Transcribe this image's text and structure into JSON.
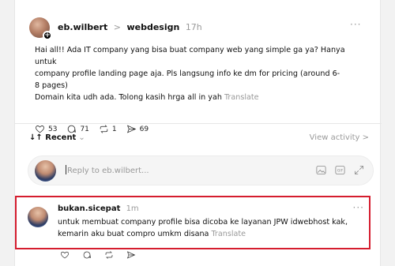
{
  "post": {
    "username": "eb.wilbert",
    "separator": ">",
    "topic": "webdesign",
    "time": "17h",
    "more": "···",
    "body_lines": [
      "Hai all!! Ada IT company yang bisa buat company web yang simple ga ya? Hanya untuk",
      "company profile landing page aja. Pls langsung info ke dm for pricing (around 6-",
      "8 pages)",
      "Domain kita udh ada. Tolong kasih hrga all in yah"
    ],
    "translate": "Translate",
    "likes": "53",
    "replies": "71",
    "reposts": "1",
    "shares": "69"
  },
  "sort": {
    "label": "Recent",
    "view_activity": "View activity >"
  },
  "reply_box": {
    "placeholder": "Reply to eb.wilbert..."
  },
  "comment": {
    "username": "bukan.sicepat",
    "time": "1m",
    "more": "···",
    "body_lines": [
      "untuk membuat company profile bisa dicoba ke layanan JPW idwebhost kak,",
      "kemarin aku buat compro umkm disana"
    ],
    "translate": "Translate"
  },
  "icons": {
    "post_actions": [
      "heart-icon",
      "comment-icon",
      "repost-icon",
      "share-icon"
    ],
    "reply_box": [
      "image-icon",
      "gif-icon",
      "expand-icon"
    ],
    "comment_actions": [
      "heart-icon",
      "comment-icon",
      "repost-icon",
      "share-icon"
    ]
  },
  "colors": {
    "highlight_border": "#d51d2e",
    "muted_text": "#9a9a9a"
  }
}
